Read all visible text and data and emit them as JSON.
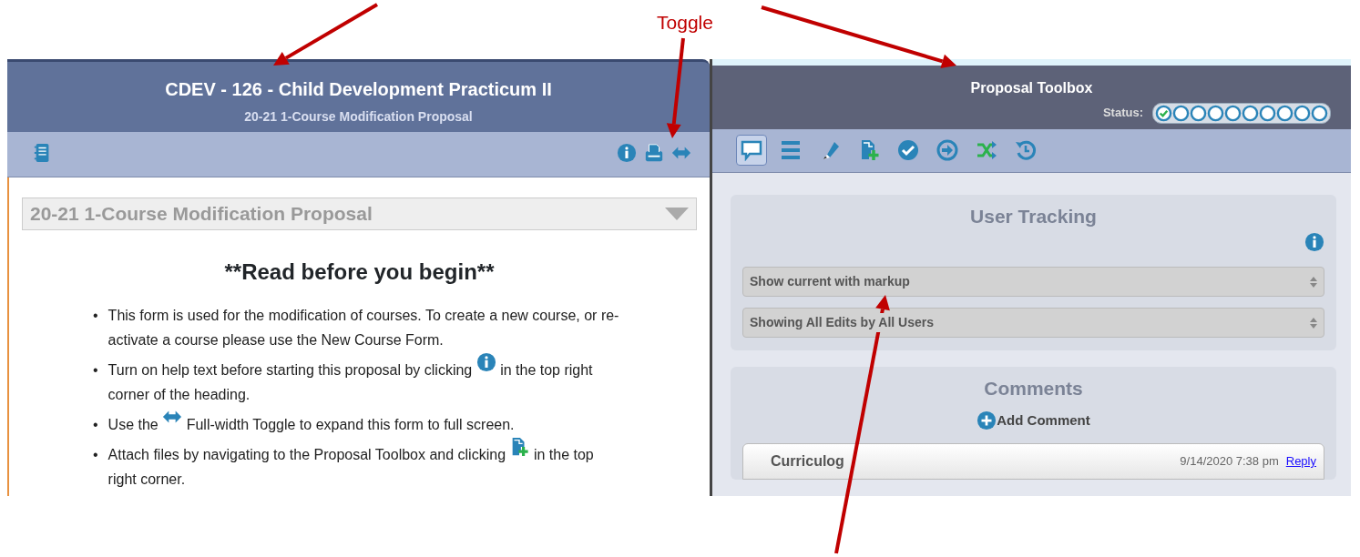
{
  "annotation": {
    "label": "Toggle"
  },
  "proposal": {
    "title": "CDEV - 126 - Child Development Practicum II",
    "subtitle": "20-21 1-Course Modification Proposal",
    "toolbar_left": [
      {
        "kind": "book"
      }
    ],
    "toolbar_right": [
      {
        "kind": "info"
      },
      {
        "kind": "print"
      },
      {
        "kind": "toggle"
      }
    ],
    "section_title": "20-21 1-Course Modification Proposal",
    "heading": "**Read before you begin**",
    "bullets": [
      {
        "kind": "text",
        "marker": "•",
        "before": "This form is used for the modification of courses. To create a new course, or re-activate a course please use the New Course Form."
      },
      {
        "kind": "info",
        "marker": "•",
        "before": "Turn on help text before starting this proposal by clicking",
        "after": "in the top right",
        "rest": "corner of the heading."
      },
      {
        "kind": "toggle",
        "marker": "•",
        "before": "Use the",
        "after": "Full-width Toggle to expand this form to full screen."
      },
      {
        "kind": "attach",
        "marker": "•",
        "before": "Attach files by navigating to the Proposal Toolbox and clicking",
        "after": "in the top",
        "rest": "right corner."
      }
    ]
  },
  "toolbox": {
    "title": "Proposal Toolbox",
    "status_label": "Status:",
    "status_steps": [
      {
        "checked": true
      },
      {
        "checked": false
      },
      {
        "checked": false
      },
      {
        "checked": false
      },
      {
        "checked": false
      },
      {
        "checked": false
      },
      {
        "checked": false
      },
      {
        "checked": false
      },
      {
        "checked": false
      },
      {
        "checked": false
      }
    ],
    "tools": [
      {
        "kind": "comment",
        "selected": true
      },
      {
        "kind": "list",
        "selected": false
      },
      {
        "kind": "edit",
        "selected": false
      },
      {
        "kind": "attach",
        "selected": false
      },
      {
        "kind": "check",
        "selected": false
      },
      {
        "kind": "forward",
        "selected": false
      },
      {
        "kind": "shuffle",
        "selected": false
      },
      {
        "kind": "history",
        "selected": false
      }
    ],
    "tracking": {
      "title": "User Tracking",
      "selects": [
        {
          "value": "Show current with markup"
        },
        {
          "value": "Showing All Edits by All Users"
        }
      ]
    },
    "comments": {
      "title": "Comments",
      "add_label": "Add Comment",
      "items": [
        {
          "author": "Curriculog",
          "time": "9/14/2020 7:38 pm",
          "reply": "Reply"
        }
      ]
    }
  }
}
